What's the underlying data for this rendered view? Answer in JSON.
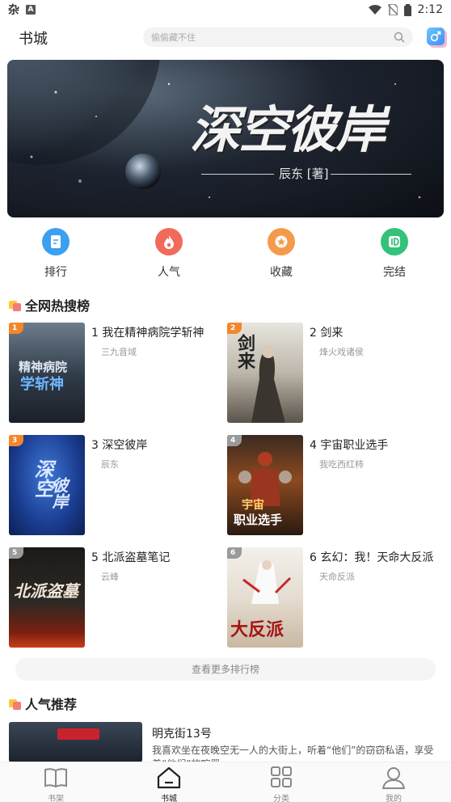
{
  "status_bar": {
    "time": "2:12",
    "app_icon_1": "杂",
    "app_icon_2": "A"
  },
  "header": {
    "title": "书城",
    "search_placeholder": "偷偷藏不住"
  },
  "banner": {
    "title": "深空彼岸",
    "author_line": "辰东 [著]"
  },
  "quick_nav": [
    {
      "label": "排行",
      "color": "#3aa0f2"
    },
    {
      "label": "人气",
      "color": "#f26a5a"
    },
    {
      "label": "收藏",
      "color": "#f59a4a"
    },
    {
      "label": "完结",
      "color": "#34c27a"
    }
  ],
  "hot_section": {
    "title": "全网热搜榜"
  },
  "rankings": [
    {
      "rank": "1",
      "title": "1 我在精神病院学斩神",
      "author": "三九音域",
      "badge_color": "#f5862b"
    },
    {
      "rank": "2",
      "title": "2 剑来",
      "author": "烽火戏诸侯",
      "badge_color": "#f5862b"
    },
    {
      "rank": "3",
      "title": "3 深空彼岸",
      "author": "辰东",
      "badge_color": "#f5862b"
    },
    {
      "rank": "4",
      "title": "4 宇宙职业选手",
      "author": "我吃西红柿",
      "badge_color": "#9a9a9a"
    },
    {
      "rank": "5",
      "title": "5 北派盗墓笔记",
      "author": "云峰",
      "badge_color": "#9a9a9a"
    },
    {
      "rank": "6",
      "title": "6 玄幻：我！天命大反派",
      "author": "天命反派",
      "badge_color": "#9a9a9a"
    }
  ],
  "more_button": "查看更多排行榜",
  "popular_section": {
    "title": "人气推荐"
  },
  "recommendation": {
    "title": "明克街13号",
    "description": "我喜欢坐在夜晚空无一人的大街上，听着“他们”的窃窃私语，享受着“他们”的喧嚣"
  },
  "bottom_nav": [
    {
      "label": "书架",
      "icon": "book-open-icon"
    },
    {
      "label": "书城",
      "icon": "home-icon",
      "active": true
    },
    {
      "label": "分类",
      "icon": "grid-icon"
    },
    {
      "label": "我的",
      "icon": "user-icon"
    }
  ]
}
